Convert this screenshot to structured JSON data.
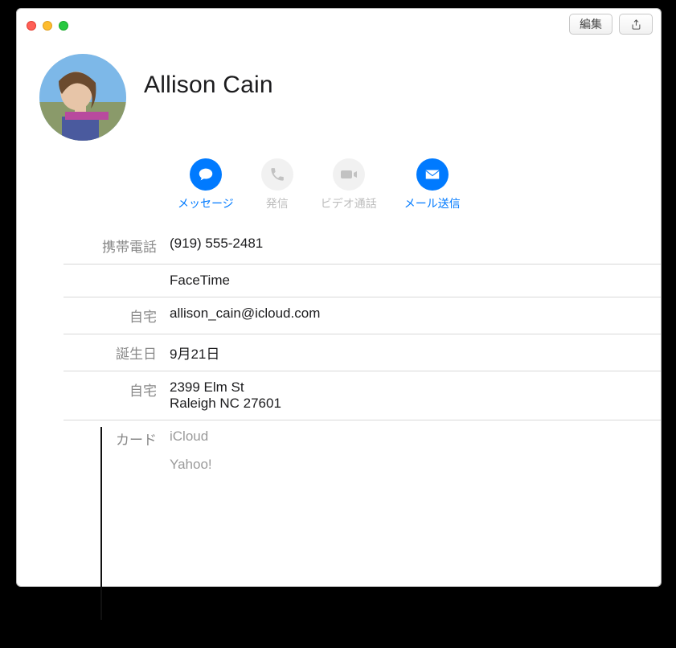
{
  "toolbar": {
    "edit_label": "編集"
  },
  "contact": {
    "name": "Allison Cain",
    "actions": {
      "message": "メッセージ",
      "call": "発信",
      "video": "ビデオ通話",
      "mail": "メール送信"
    },
    "fields": [
      {
        "label": "携帯電話",
        "value": "(919) 555-2481"
      },
      {
        "label": "",
        "value": "FaceTime"
      },
      {
        "label": "自宅",
        "value": "allison_cain@icloud.com"
      },
      {
        "label": "誕生日",
        "value": "9月21日"
      },
      {
        "label": "自宅",
        "value": "2399 Elm St\nRaleigh NC 27601"
      }
    ],
    "card_label": "カード",
    "cards": [
      "iCloud",
      "Yahoo!"
    ]
  },
  "icons": {
    "message": "message-bubble-icon",
    "call": "phone-icon",
    "video": "video-icon",
    "mail": "envelope-icon",
    "share": "share-icon"
  }
}
